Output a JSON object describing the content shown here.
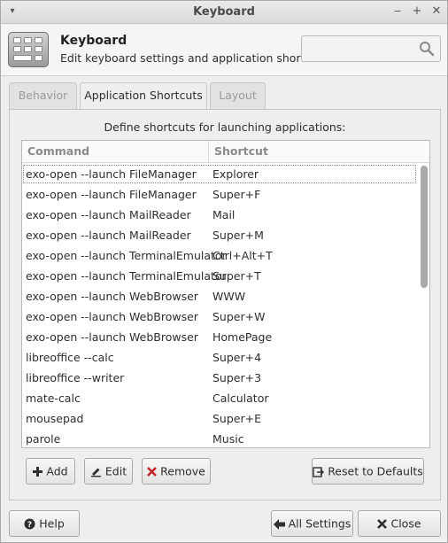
{
  "window": {
    "title": "Keyboard",
    "menu_glyph": "▾",
    "controls": {
      "minimize": "‒",
      "maximize": "+",
      "close": "✕"
    }
  },
  "header": {
    "title": "Keyboard",
    "subtitle": "Edit keyboard settings and application shortcuts",
    "search": {
      "value": "",
      "placeholder": ""
    },
    "icon": "keyboard-icon"
  },
  "tabs": [
    {
      "label": "Behavior",
      "active": false
    },
    {
      "label": "Application Shortcuts",
      "active": true
    },
    {
      "label": "Layout",
      "active": false
    }
  ],
  "panel": {
    "label": "Define shortcuts for launching applications:",
    "columns": [
      "Command",
      "Shortcut"
    ],
    "rows": [
      {
        "command": "exo-open --launch FileManager",
        "shortcut": "Explorer"
      },
      {
        "command": "exo-open --launch FileManager",
        "shortcut": "Super+F"
      },
      {
        "command": "exo-open --launch MailReader",
        "shortcut": "Mail"
      },
      {
        "command": "exo-open --launch MailReader",
        "shortcut": "Super+M"
      },
      {
        "command": "exo-open --launch TerminalEmulator",
        "shortcut": "Ctrl+Alt+T"
      },
      {
        "command": "exo-open --launch TerminalEmulator",
        "shortcut": "Super+T"
      },
      {
        "command": "exo-open --launch WebBrowser",
        "shortcut": "WWW"
      },
      {
        "command": "exo-open --launch WebBrowser",
        "shortcut": "Super+W"
      },
      {
        "command": "exo-open --launch WebBrowser",
        "shortcut": "HomePage"
      },
      {
        "command": "libreoffice --calc",
        "shortcut": "Super+4"
      },
      {
        "command": "libreoffice --writer",
        "shortcut": "Super+3"
      },
      {
        "command": "mate-calc",
        "shortcut": "Calculator"
      },
      {
        "command": "mousepad",
        "shortcut": "Super+E"
      },
      {
        "command": "parole",
        "shortcut": "Music"
      }
    ],
    "buttons": {
      "add": "Add",
      "edit": "Edit",
      "remove": "Remove",
      "reset": "Reset to Defaults"
    }
  },
  "footer": {
    "help": "Help",
    "all_settings": "All Settings",
    "close": "Close"
  },
  "colors": {
    "remove_icon": "#c0282d",
    "scrollbar": "#a9a9a7"
  }
}
